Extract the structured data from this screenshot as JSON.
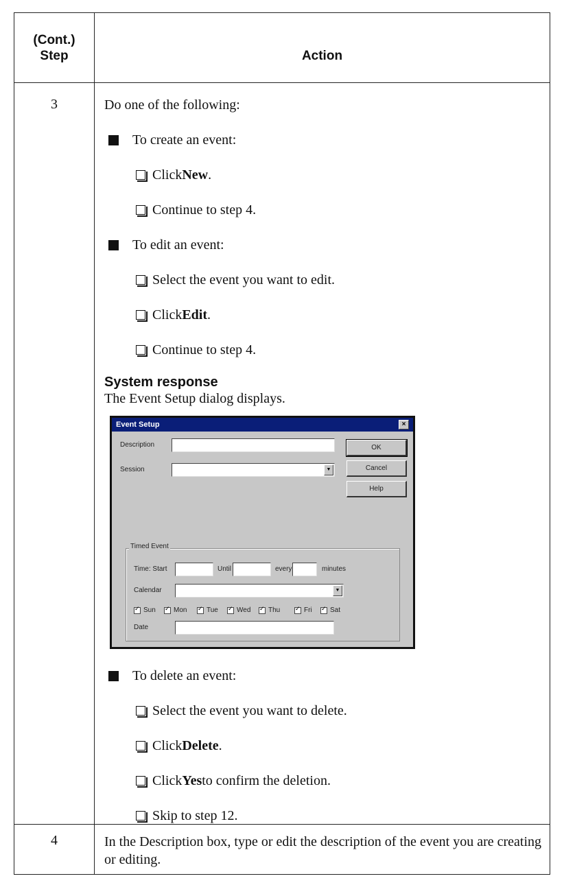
{
  "header": {
    "step_label": "(Cont.)\nStep",
    "action_label": "Action"
  },
  "row3": {
    "step": "3",
    "intro": "Do one of the following:",
    "create": {
      "bullet": "To create an event:",
      "sub": [
        {
          "pre": "Click ",
          "bold": "New",
          "post": "."
        },
        {
          "pre": "Continue to step 4.",
          "bold": "",
          "post": ""
        }
      ]
    },
    "edit": {
      "bullet": "To edit an event:",
      "sub": [
        {
          "pre": "Select the event you want to edit.",
          "bold": "",
          "post": ""
        },
        {
          "pre": "Click ",
          "bold": "Edit",
          "post": "."
        },
        {
          "pre": "Continue to step 4.",
          "bold": "",
          "post": ""
        }
      ]
    },
    "response_title": "System response",
    "response_text": "The Event Setup dialog displays.",
    "delete": {
      "bullet": "To delete an event:",
      "sub": [
        {
          "pre": "Select the event you want to delete.",
          "bold": "",
          "post": ""
        },
        {
          "pre": "Click ",
          "bold": "Delete",
          "post": "."
        },
        {
          "pre": "Click ",
          "bold": "Yes",
          "post": " to confirm the deletion."
        },
        {
          "pre": "Skip to step 12.",
          "bold": "",
          "post": ""
        }
      ]
    }
  },
  "dialog": {
    "title": "Event Setup",
    "close": "×",
    "description_label": "Description",
    "session_label": "Session",
    "ok": "OK",
    "cancel": "Cancel",
    "help": "Help",
    "group_label": "Timed Event",
    "time_start_label": "Time: Start",
    "until_label": "Until",
    "every_label": "every",
    "minutes_label": "minutes",
    "calendar_label": "Calendar",
    "date_label": "Date",
    "days": [
      "Sun",
      "Mon",
      "Tue",
      "Wed",
      "Thu",
      "Fri",
      "Sat"
    ]
  },
  "row4": {
    "step": "4",
    "text": "In the Description box, type or edit the description of the event you are creating or editing."
  }
}
